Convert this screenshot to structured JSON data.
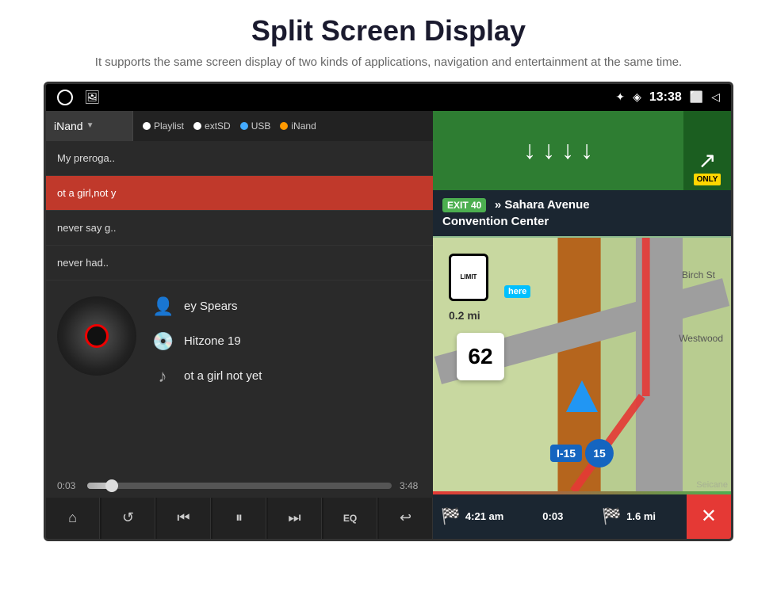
{
  "page": {
    "title": "Split Screen Display",
    "subtitle": "It supports the same screen display of two kinds of applications,\nnavigation and entertainment at the same time."
  },
  "status_bar": {
    "time": "13:38",
    "bluetooth_icon": "★",
    "location_icon": "◈",
    "window_icon": "⬜",
    "back_icon": "◁"
  },
  "music_player": {
    "source_selected": "iNand",
    "sources": [
      "Playlist",
      "extSD",
      "USB",
      "iNand"
    ],
    "playlist": [
      {
        "title": "My preroga..",
        "active": false,
        "selected": false
      },
      {
        "title": "ot a girl,not y",
        "active": true,
        "selected": false
      },
      {
        "title": "never say g..",
        "active": false,
        "selected": false
      },
      {
        "title": "never had..",
        "active": false,
        "selected": false
      }
    ],
    "artist": "ey Spears",
    "album": "Hitzone 19",
    "song": "ot a girl not yet",
    "time_current": "0:03",
    "time_total": "3:48",
    "controls": [
      {
        "id": "home",
        "icon": "⌂",
        "label": "home"
      },
      {
        "id": "repeat",
        "icon": "↺",
        "label": "repeat"
      },
      {
        "id": "prev",
        "icon": "⏮",
        "label": "previous"
      },
      {
        "id": "pause",
        "icon": "⏸",
        "label": "pause"
      },
      {
        "id": "next",
        "icon": "⏭",
        "label": "next"
      },
      {
        "id": "eq",
        "icon": "EQ",
        "label": "equalizer"
      },
      {
        "id": "back",
        "icon": "↩",
        "label": "back"
      }
    ]
  },
  "navigation": {
    "exit_number": "EXIT 40",
    "instruction_line1": "» Sahara Avenue",
    "instruction_line2": "Convention Center",
    "speed": "62",
    "distance_to_turn": "0.2 mi",
    "speed_limit": "LIMIT",
    "speed_limit_num": "",
    "highway_label": "I-15",
    "highway_num": "15",
    "eta_time": "4:21 am",
    "eta_duration": "0:03",
    "eta_distance": "1.6 mi",
    "only_label": "ONLY"
  },
  "colors": {
    "accent_red": "#c0392b",
    "nav_green": "#2e7d32",
    "nav_blue": "#1565c0",
    "status_bar_bg": "#000000",
    "player_bg": "#2a2a2a",
    "controls_bg": "#1a1a1a"
  }
}
